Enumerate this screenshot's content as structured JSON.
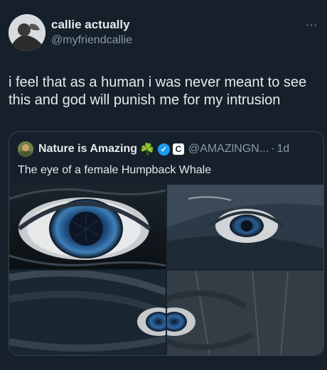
{
  "tweet": {
    "display_name": "callie actually",
    "handle": "@myfriendcallie",
    "text": "i feel that as a human i was never meant to see this and god will punish me for my intrusion",
    "more_icon": "more-dots-icon"
  },
  "quote": {
    "display_name": "Nature is Amazing",
    "emoji": "☘️",
    "affiliate_letter": "C",
    "handle": "@AMAZlNGN...",
    "separator": "·",
    "time": "1d",
    "text": "The eye of a female Humpback Whale",
    "images": [
      "whale-eye-closeup-image",
      "whale-eye-side-image",
      "whale-eye-folds-image",
      "whale-eye-wrinkled-image"
    ]
  }
}
